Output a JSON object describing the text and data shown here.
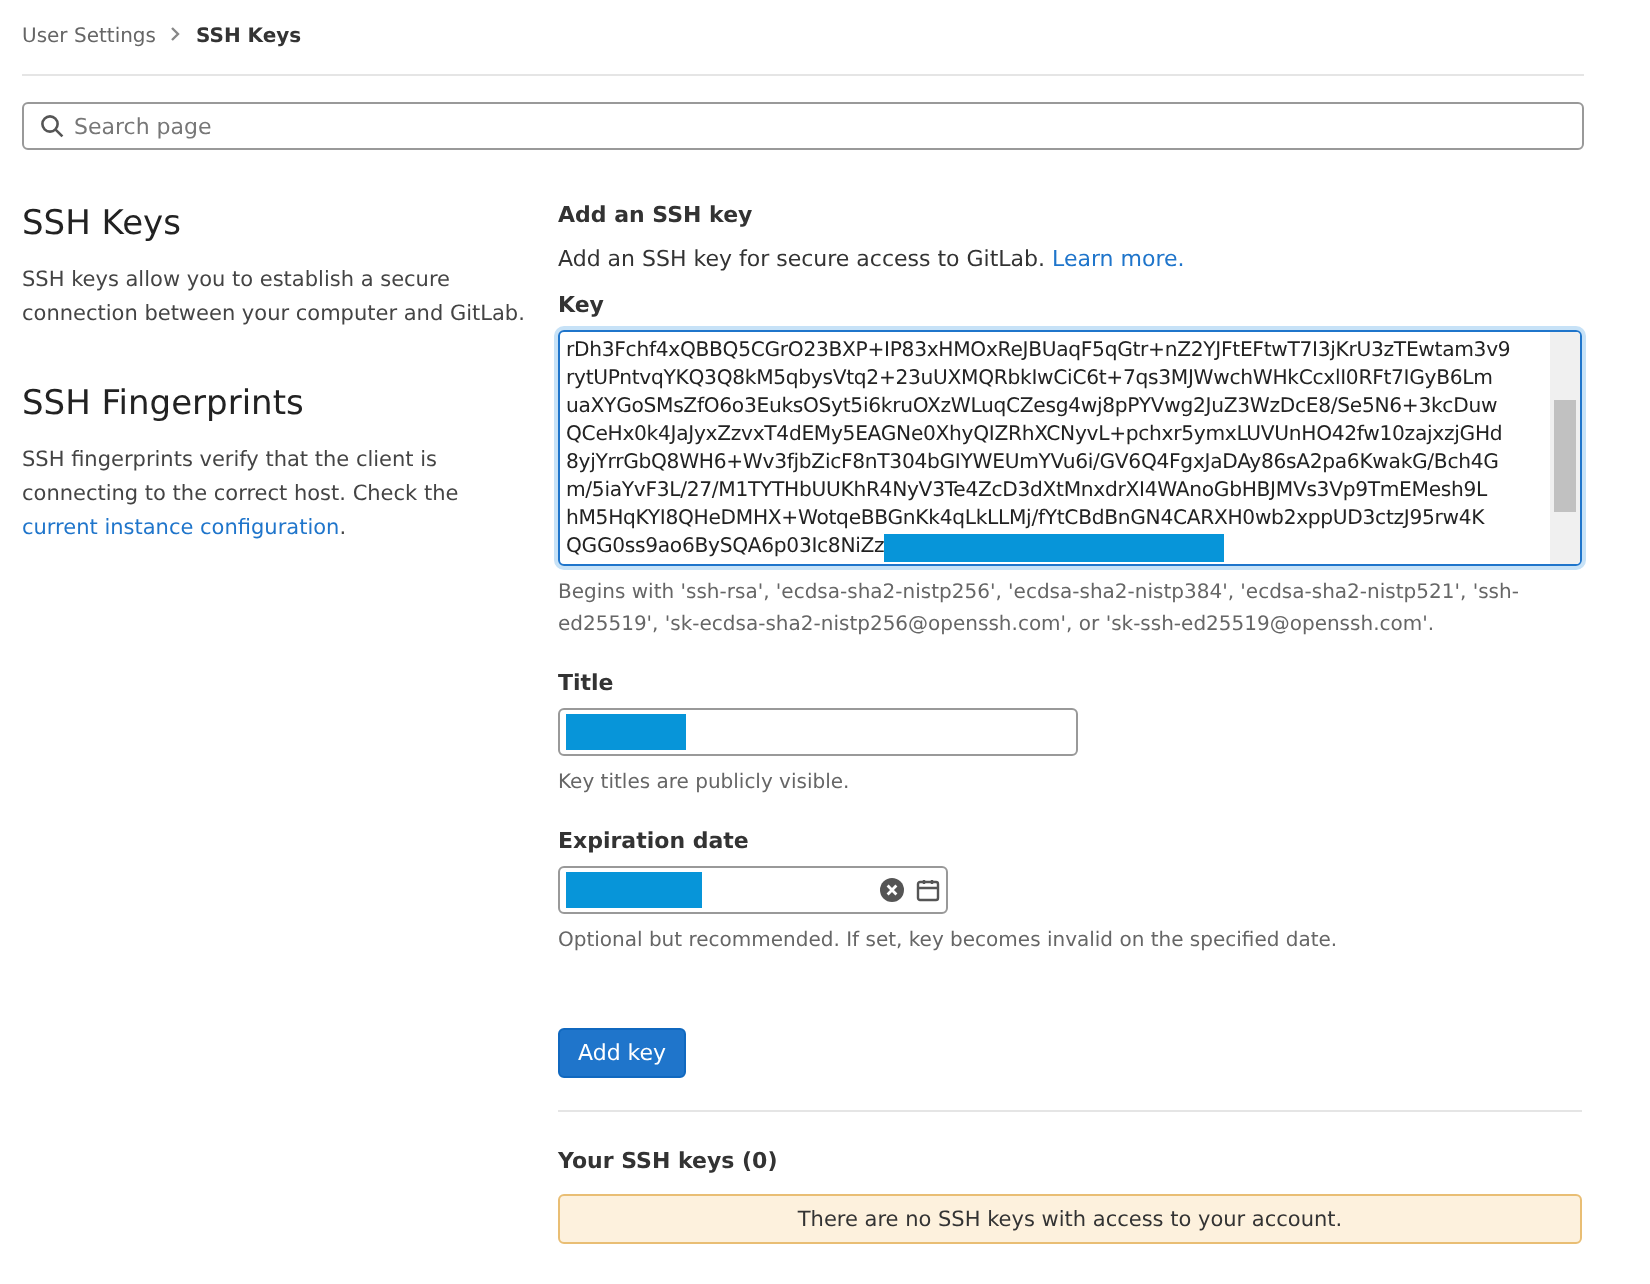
{
  "breadcrumb": [
    {
      "label": "User Settings",
      "current": false
    },
    {
      "label": "SSH Keys",
      "current": true
    }
  ],
  "search": {
    "placeholder": "Search page"
  },
  "sidebar": [
    {
      "heading": "SSH Keys",
      "text": "SSH keys allow you to establish a secure connection between your computer and GitLab."
    },
    {
      "heading": "SSH Fingerprints",
      "text": "SSH fingerprints verify that the client is connecting to the correct host. Check the",
      "link": "current instance configuration",
      "after": "."
    }
  ],
  "form": {
    "heading": "Add an SSH key",
    "intro": "Add an SSH key for secure access to GitLab.",
    "intro_link": "Learn more.",
    "key": {
      "label": "Key",
      "lines": [
        "rDh3Fchf4xQBBQ5CGrO23BXP+IP83xHMOxReJBUaqF5qGtr+nZ2YJFtEFtwT7I3jKrU3zTEwtam3v9",
        "rytUPntvqYKQ3Q8kM5qbysVtq2+23uUXMQRbkIwCiC6t+7qs3MJWwchWHkCcxlI0RFt7IGyB6Lm",
        "uaXYGoSMsZfO6o3EuksOSyt5i6kruOXzWLuqCZesg4wj8pPYVwg2JuZ3WzDcE8/Se5N6+3kcDuw",
        "QCeHx0k4JaJyxZzvxT4dEMy5EAGNe0XhyQIZRhXCNyvL+pchxr5ymxLUVUnHO42fw10zajxzjGHd",
        "8yjYrrGbQ8WH6+Wv3fjbZicF8nT304bGIYWEUmYVu6i/GV6Q4FgxJaDAy86sA2pa6KwakG/Bch4G",
        "m/5iaYvF3L/27/M1TYTHbUUKhR4NyV3Te4ZcD3dXtMnxdrXI4WAnoGbHBJMVs3Vp9TmEMesh9L",
        "hM5HqKYI8QHeDMHX+WotqeBBGnKk4qLkLLMj/fYtCBdBnGN4CARXH0wb2xppUD3ctzJ95rw4K",
        "QGG0ss9ao6BySQA6p03Ic8NiZz"
      ],
      "redacted": true,
      "focused": true,
      "help": "Begins with 'ssh-rsa', 'ecdsa-sha2-nistp256', 'ecdsa-sha2-nistp384', 'ecdsa-sha2-nistp521', 'ssh-ed25519', 'sk-ecdsa-sha2-nistp256@openssh.com', or 'sk-ssh-ed25519@openssh.com'."
    },
    "title": {
      "label": "Title",
      "redacted": true,
      "help": "Key titles are publicly visible."
    },
    "expiration": {
      "label": "Expiration date",
      "redacted": true,
      "help": "Optional but recommended. If set, key becomes invalid on the specified date."
    },
    "submit": "Add key"
  },
  "keys": {
    "heading": "Your SSH keys (0)",
    "empty": "There are no SSH keys with access to your account."
  }
}
